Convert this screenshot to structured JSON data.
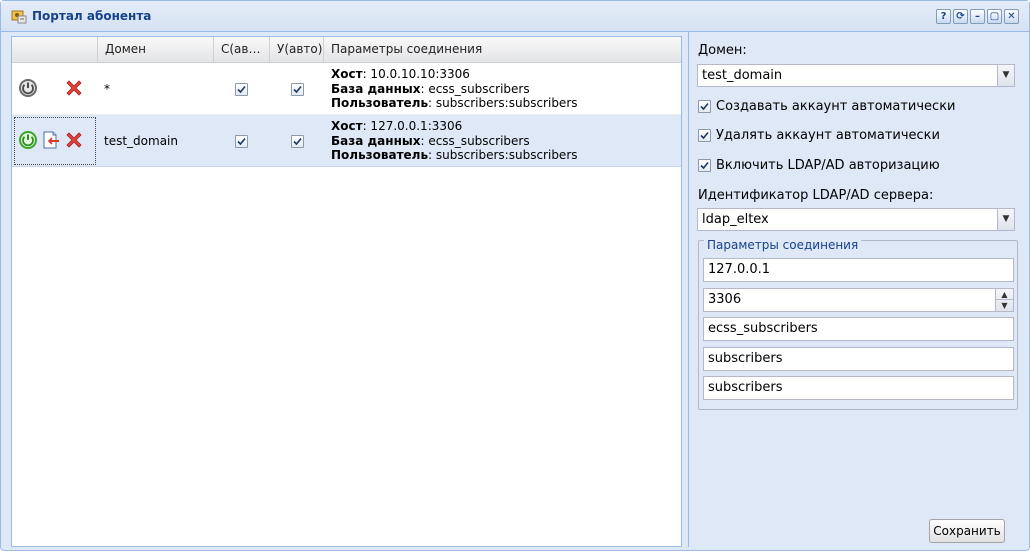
{
  "window": {
    "title": "Портал абонента",
    "icon": "portal-app-icon",
    "tools": [
      {
        "name": "help-icon",
        "glyph": "?"
      },
      {
        "name": "refresh-icon",
        "glyph": "⟳"
      },
      {
        "name": "minimize-icon",
        "glyph": "–"
      },
      {
        "name": "maximize-icon",
        "glyph": "▢"
      },
      {
        "name": "close-icon",
        "glyph": "✕"
      }
    ]
  },
  "grid": {
    "columns": {
      "actions": "",
      "domain": "Домен",
      "create_auto": "С(ав…",
      "delete_auto": "У(авто)",
      "params": "Параметры соединения"
    },
    "rows": [
      {
        "domain": "*",
        "create_auto": true,
        "delete_auto": true,
        "host_label": "Хост",
        "host": ": 10.0.10.10:3306",
        "db_label": "База данных",
        "db": ": ecss_subscribers",
        "user_label": "Пользователь",
        "user": ": subscribers:subscribers",
        "status_icon": "power-off-icon",
        "selected": false
      },
      {
        "domain": "test_domain",
        "create_auto": true,
        "delete_auto": true,
        "host_label": "Хост",
        "host": ": 127.0.0.1:3306",
        "db_label": "База данных",
        "db": ": ecss_subscribers",
        "user_label": "Пользователь",
        "user": ": subscribers:subscribers",
        "status_icon": "power-on-icon",
        "selected": true
      }
    ]
  },
  "form": {
    "domain_label": "Домен:",
    "domain_value": "test_domain",
    "create_auto_label": "Создавать аккаунт автоматически",
    "create_auto_checked": true,
    "delete_auto_label": "Удалять аккаунт автоматически",
    "delete_auto_checked": true,
    "ldap_enable_label": "Включить LDAP/AD авторизацию",
    "ldap_enable_checked": true,
    "ldap_server_label": "Идентификатор LDAP/AD сервера:",
    "ldap_server_value": "ldap_eltex",
    "conn_legend": "Параметры соединения",
    "host": "127.0.0.1",
    "port": "3306",
    "database": "ecss_subscribers",
    "user": "subscribers",
    "password": "subscribers",
    "save_label": "Сохранить"
  },
  "colors": {
    "accent": "#15428b",
    "panel_bg": "#dfe8f6",
    "border": "#99bbe8",
    "selected_row": "#dfe8f6"
  }
}
